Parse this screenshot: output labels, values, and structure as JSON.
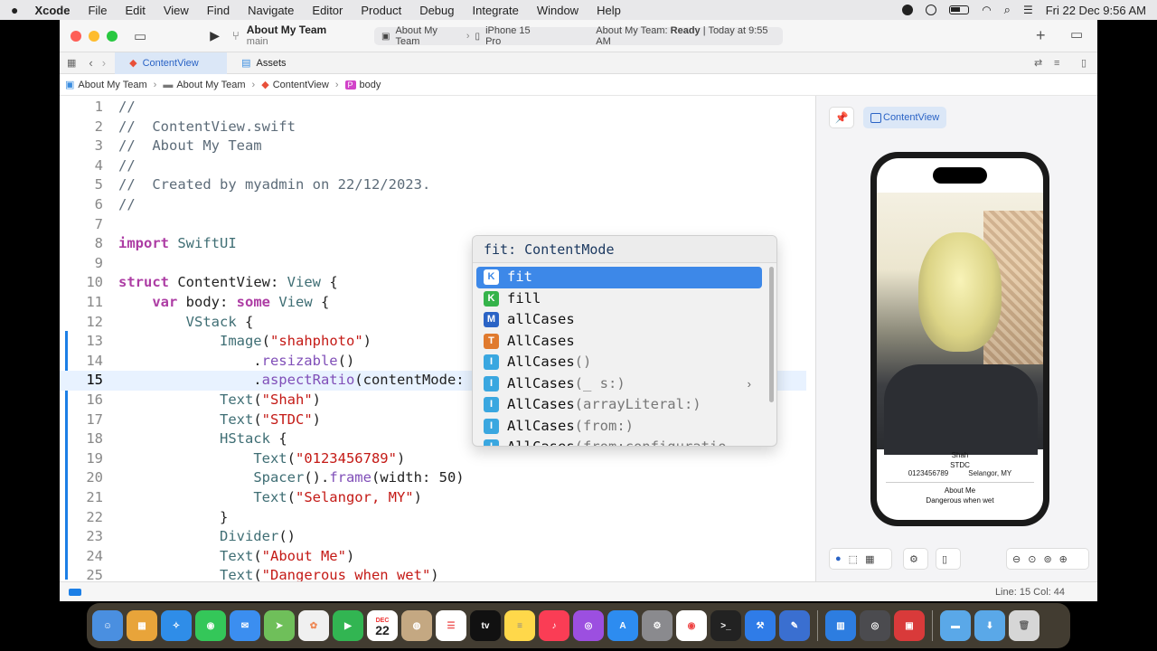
{
  "menubar": {
    "apple": "",
    "items": [
      "Xcode",
      "File",
      "Edit",
      "View",
      "Find",
      "Navigate",
      "Editor",
      "Product",
      "Debug",
      "Integrate",
      "Window",
      "Help"
    ],
    "datetime": "Fri 22 Dec  9:56 AM"
  },
  "toolbar": {
    "project_title": "About My Team",
    "branch": "main",
    "scheme_target": "About My Team",
    "scheme_device": "iPhone 15 Pro",
    "status_prefix": "About My Team: ",
    "status_state": "Ready",
    "status_time": " | Today at 9:55 AM",
    "add": "+"
  },
  "tabs": [
    {
      "label": "ContentView",
      "active": true
    },
    {
      "label": "Assets",
      "active": false
    }
  ],
  "breadcrumb": [
    "About My Team",
    "About My Team",
    "ContentView",
    "body"
  ],
  "editor": {
    "current_line": 15,
    "lines": [
      {
        "n": "1",
        "code": "//"
      },
      {
        "n": "2",
        "code": "//  ContentView.swift"
      },
      {
        "n": "3",
        "code": "//  About My Team"
      },
      {
        "n": "4",
        "code": "//"
      },
      {
        "n": "5",
        "code": "//  Created by myadmin on 22/12/2023."
      },
      {
        "n": "6",
        "code": "//"
      },
      {
        "n": "7",
        "code": ""
      },
      {
        "n": "8",
        "code": "import SwiftUI"
      },
      {
        "n": "9",
        "code": ""
      },
      {
        "n": "10",
        "code": "struct ContentView: View {"
      },
      {
        "n": "11",
        "code": "    var body: some View {"
      },
      {
        "n": "12",
        "code": "        VStack {"
      },
      {
        "n": "13",
        "code": "            Image(\"shahphoto\")"
      },
      {
        "n": "14",
        "code": "                .resizable()"
      },
      {
        "n": "15",
        "code": "                .aspectRatio(contentMode: .)"
      },
      {
        "n": "16",
        "code": "            Text(\"Shah\")"
      },
      {
        "n": "17",
        "code": "            Text(\"STDC\")"
      },
      {
        "n": "18",
        "code": "            HStack {"
      },
      {
        "n": "19",
        "code": "                Text(\"0123456789\")"
      },
      {
        "n": "20",
        "code": "                Spacer().frame(width: 50)"
      },
      {
        "n": "21",
        "code": "                Text(\"Selangor, MY\")"
      },
      {
        "n": "22",
        "code": "            }"
      },
      {
        "n": "23",
        "code": "            Divider()"
      },
      {
        "n": "24",
        "code": "            Text(\"About Me\")"
      },
      {
        "n": "25",
        "code": "            Text(\"Dangerous when wet\")"
      }
    ]
  },
  "completion": {
    "header": "fit: ContentMode",
    "items": [
      {
        "kind": "K",
        "color": "#3d88e8",
        "name": "fit",
        "args": "",
        "selected": true
      },
      {
        "kind": "K",
        "color": "#35b34a",
        "name": "fill",
        "args": ""
      },
      {
        "kind": "M",
        "color": "#2a63c5",
        "name": "allCases",
        "args": ""
      },
      {
        "kind": "T",
        "color": "#e07a2e",
        "name": "AllCases",
        "args": ""
      },
      {
        "kind": "I",
        "color": "#3aa7e0",
        "name": "AllCases",
        "args": "()"
      },
      {
        "kind": "I",
        "color": "#3aa7e0",
        "name": "AllCases",
        "args": "(_ s:)",
        "chevron": "›"
      },
      {
        "kind": "I",
        "color": "#3aa7e0",
        "name": "AllCases",
        "args": "(arrayLiteral:)"
      },
      {
        "kind": "I",
        "color": "#3aa7e0",
        "name": "AllCases",
        "args": "(from:)"
      },
      {
        "kind": "I",
        "color": "#3aa7e0",
        "name": "AllCases",
        "args": "(from:configuratio"
      }
    ]
  },
  "preview": {
    "chip": "ContentView",
    "name": "Shah",
    "org": "STDC",
    "phone": "0123456789",
    "location": "Selangor, MY",
    "about_title": "About Me",
    "about_text": "Dangerous when wet"
  },
  "statusbar": {
    "position": "Line: 15  Col: 44"
  },
  "dock": {
    "calendar_month": "DEC",
    "calendar_day": "22",
    "tv_label": "tv"
  }
}
